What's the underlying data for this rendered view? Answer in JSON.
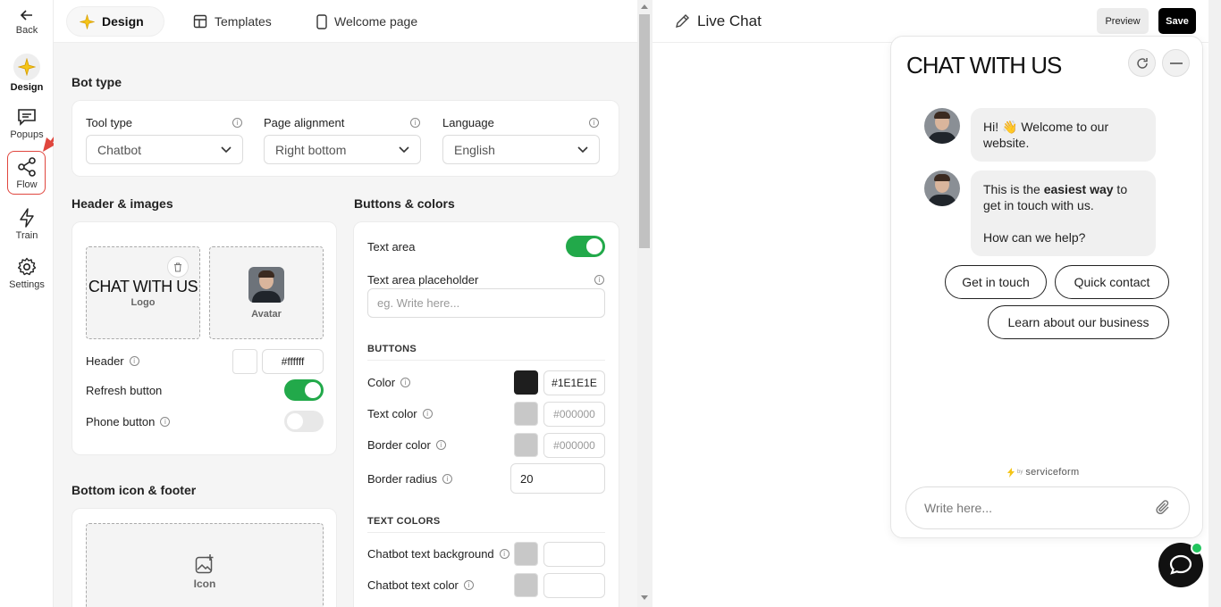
{
  "nav": {
    "back": "Back",
    "items": [
      {
        "label": "Design",
        "icon": "sparkle-icon"
      },
      {
        "label": "Popups",
        "icon": "message-icon"
      },
      {
        "label": "Flow",
        "icon": "share-icon"
      },
      {
        "label": "Train",
        "icon": "lightning-icon"
      },
      {
        "label": "Settings",
        "icon": "gear-icon"
      }
    ]
  },
  "tabs": [
    {
      "label": "Design",
      "icon": "sparkle-icon"
    },
    {
      "label": "Templates",
      "icon": "templates-icon"
    },
    {
      "label": "Welcome page",
      "icon": "phone-icon"
    }
  ],
  "bot_type": {
    "title": "Bot type",
    "tool_type_label": "Tool type",
    "tool_type_value": "Chatbot",
    "alignment_label": "Page alignment",
    "alignment_value": "Right bottom",
    "language_label": "Language",
    "language_value": "English"
  },
  "header_images": {
    "title": "Header & images",
    "logo_text": "CHAT WITH US",
    "logo_caption": "Logo",
    "avatar_caption": "Avatar",
    "header_label": "Header",
    "header_color": "#ffffff",
    "refresh_label": "Refresh button",
    "refresh_on": true,
    "phone_label": "Phone button",
    "phone_on": false
  },
  "bottom": {
    "title": "Bottom icon & footer",
    "icon_caption": "Icon"
  },
  "buttons_colors": {
    "title": "Buttons & colors",
    "text_area_label": "Text area",
    "text_area_on": true,
    "placeholder_label": "Text area placeholder",
    "placeholder_hint": "eg. Write here...",
    "buttons_head": "BUTTONS",
    "color_label": "Color",
    "color_value": "#1E1E1E",
    "text_color_label": "Text color",
    "text_color_value": "#000000",
    "border_color_label": "Border color",
    "border_color_value": "#000000",
    "border_radius_label": "Border radius",
    "border_radius_value": "20",
    "text_colors_head": "TEXT COLORS",
    "chatbot_bg_label": "Chatbot text background",
    "chatbot_text_label": "Chatbot text color"
  },
  "preview": {
    "title": "Live Chat",
    "preview_btn": "Preview",
    "save_btn": "Save",
    "chat_header": "CHAT WITH US",
    "msg1": "Hi! 👋 Welcome to our website.",
    "msg2_pre": "This is the ",
    "msg2_bold": "easiest way",
    "msg2_post": " to get in touch with us.",
    "msg2_q": "How can we help?",
    "options": [
      "Get in touch",
      "Quick contact",
      "Learn about our business"
    ],
    "powered_by": "by",
    "brand": "serviceform",
    "input_placeholder": "Write here..."
  },
  "colors": {
    "accent": "#22a94a",
    "dark": "#1e1e1e",
    "highlight": "#e0463e"
  }
}
